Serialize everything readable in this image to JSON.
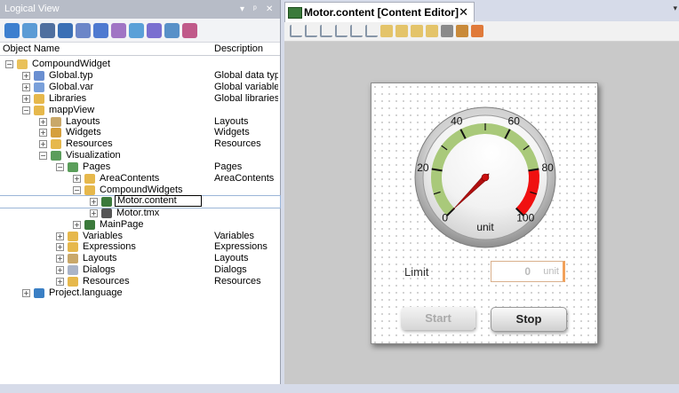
{
  "logical_view": {
    "title": "Logical View",
    "controls": {
      "dropdown": "▾",
      "pin": "ᵖ",
      "close": "✕"
    },
    "toolbar_icons": [
      "project-icon",
      "table-icon",
      "window-icon",
      "chart-icon",
      "puzzle-icon",
      "check-icon",
      "puzzle2-icon",
      "pencil-icon",
      "arrows-icon",
      "gear2-icon",
      "link-icon"
    ],
    "columns": {
      "name": "Object Name",
      "description": "Description"
    },
    "tree": [
      {
        "label": "CompoundWidget",
        "desc": "",
        "level": 0,
        "exp": "−",
        "icon": "package-icon",
        "color": "#e9c15a"
      },
      {
        "label": "Global.typ",
        "desc": "Global data typ",
        "level": 1,
        "exp": "+",
        "icon": "datatype-icon",
        "color": "#6a8fd1"
      },
      {
        "label": "Global.var",
        "desc": "Global variable",
        "level": 1,
        "exp": "+",
        "icon": "variable-icon",
        "color": "#7aa0da"
      },
      {
        "label": "Libraries",
        "desc": "Global libraries",
        "level": 1,
        "exp": "+",
        "icon": "folder-icon",
        "color": "#e6b84c"
      },
      {
        "label": "mappView",
        "desc": "",
        "level": 1,
        "exp": "−",
        "icon": "folder-open-icon",
        "color": "#e6b84c"
      },
      {
        "label": "Layouts",
        "desc": "Layouts",
        "level": 2,
        "exp": "+",
        "icon": "layouts-icon",
        "color": "#c9a86a"
      },
      {
        "label": "Widgets",
        "desc": "Widgets",
        "level": 2,
        "exp": "+",
        "icon": "widgets-icon",
        "color": "#d59f3c"
      },
      {
        "label": "Resources",
        "desc": "Resources",
        "level": 2,
        "exp": "+",
        "icon": "folder-icon",
        "color": "#e6b84c"
      },
      {
        "label": "Visualization",
        "desc": "",
        "level": 2,
        "exp": "−",
        "icon": "visualization-icon",
        "color": "#5b9d5b"
      },
      {
        "label": "Pages",
        "desc": "Pages",
        "level": 3,
        "exp": "−",
        "icon": "pages-icon",
        "color": "#5a9e5a"
      },
      {
        "label": "AreaContents",
        "desc": "AreaContents",
        "level": 4,
        "exp": "+",
        "icon": "folder-icon",
        "color": "#e6b84c"
      },
      {
        "label": "CompoundWidgets",
        "desc": "",
        "level": 4,
        "exp": "−",
        "icon": "folder-open-icon",
        "color": "#e6b84c"
      },
      {
        "label": "Motor.content",
        "desc": "",
        "level": 5,
        "exp": "+",
        "icon": "content-icon",
        "color": "#3b7a3b",
        "selected": true
      },
      {
        "label": "Motor.tmx",
        "desc": "",
        "level": 5,
        "exp": "+",
        "icon": "text-icon",
        "color": "#555555"
      },
      {
        "label": "MainPage",
        "desc": "",
        "level": 4,
        "exp": "+",
        "icon": "page-icon",
        "color": "#3b7a3b"
      },
      {
        "label": "Variables",
        "desc": "Variables",
        "level": 3,
        "exp": "+",
        "icon": "folder-icon",
        "color": "#e6b84c"
      },
      {
        "label": "Expressions",
        "desc": "Expressions",
        "level": 3,
        "exp": "+",
        "icon": "folder-icon",
        "color": "#e6b84c"
      },
      {
        "label": "Layouts",
        "desc": "Layouts",
        "level": 3,
        "exp": "+",
        "icon": "layouts-icon",
        "color": "#c9a86a"
      },
      {
        "label": "Dialogs",
        "desc": "Dialogs",
        "level": 3,
        "exp": "+",
        "icon": "dialogs-icon",
        "color": "#aab4c8"
      },
      {
        "label": "Resources",
        "desc": "Resources",
        "level": 3,
        "exp": "+",
        "icon": "folder-icon",
        "color": "#e6b84c"
      },
      {
        "label": "Project.language",
        "desc": "",
        "level": 1,
        "exp": "+",
        "icon": "globe-icon",
        "color": "#3a7fc4"
      }
    ]
  },
  "editor": {
    "tab_label": "Motor.content [Content Editor]",
    "tab_close": "✕",
    "menu_glyph": "▾",
    "toolbar_icons": [
      "align-left-icon",
      "align-top-icon",
      "align-right-icon",
      "align-bottom-icon",
      "distribute-v-icon",
      "distribute-h-icon",
      "bring-front-icon",
      "send-back-icon",
      "group-icon",
      "ungroup-icon",
      "settings-icon",
      "palette-icon",
      "theme-icon"
    ],
    "gauge": {
      "min": 0,
      "max": 100,
      "value": 0,
      "ticks": [
        "0",
        "20",
        "40",
        "60",
        "80",
        "100"
      ],
      "unit": "unit",
      "green_range": [
        0,
        80
      ],
      "red_range": [
        80,
        100
      ],
      "green_color": "#a9c97a",
      "red_color": "#f01010"
    },
    "limit": {
      "label": "Limit",
      "value": "0",
      "unit": "unit"
    },
    "buttons": {
      "start": "Start",
      "stop": "Stop"
    }
  }
}
